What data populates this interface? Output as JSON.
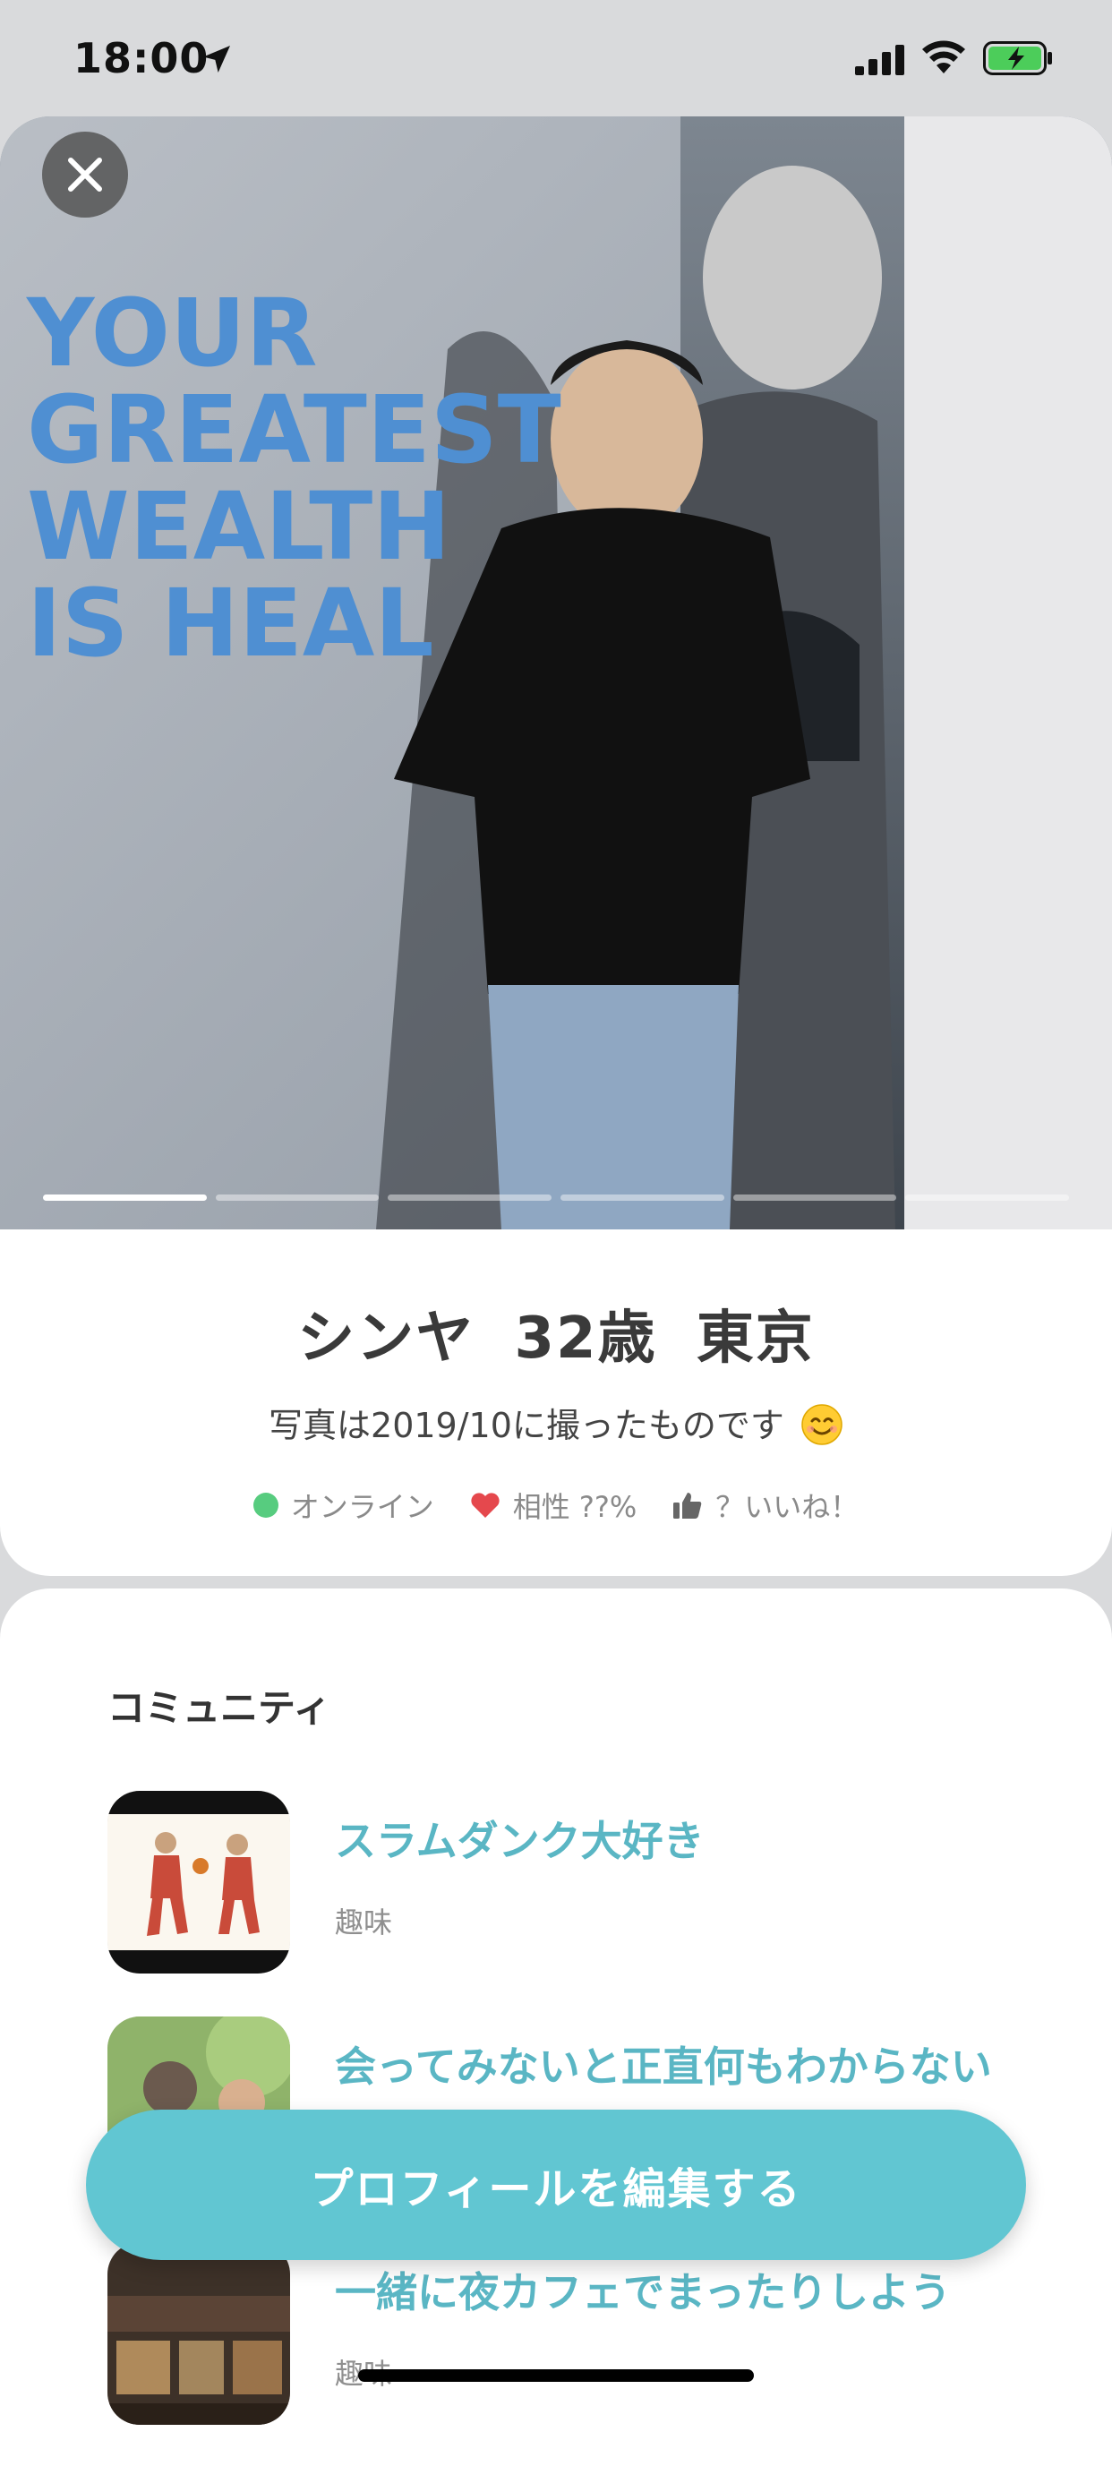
{
  "status_bar": {
    "time": "18:00",
    "icons": [
      "location-arrow-icon",
      "cellular-signal-icon",
      "wifi-icon",
      "battery-charging-icon"
    ]
  },
  "photo": {
    "poster_lines": [
      "YOUR",
      "GREATEST",
      "WEALTH",
      "IS HEAL"
    ],
    "photo_count": 6,
    "current_index": 1,
    "close_icon": "close-icon"
  },
  "profile": {
    "name": "シンヤ",
    "age": "32歳",
    "location": "東京",
    "caption": "写真は2019/10に撮ったものです",
    "online_label": "オンライン",
    "compat_label": "相性 ??%",
    "likes_label": "？いいね！",
    "colors": {
      "online": "#57cc7f",
      "heart": "#e5484d",
      "accent": "#61c6d2"
    }
  },
  "community": {
    "title": "コミュニティ",
    "items": [
      {
        "title": "スラムダンク大好き",
        "category": "趣味"
      },
      {
        "title": "会ってみないと正直何もわからない",
        "category": ""
      },
      {
        "title": "一緒に夜カフェでまったりしよう",
        "category": "趣味"
      }
    ]
  },
  "actions": {
    "edit_profile": "プロフィールを編集する"
  }
}
